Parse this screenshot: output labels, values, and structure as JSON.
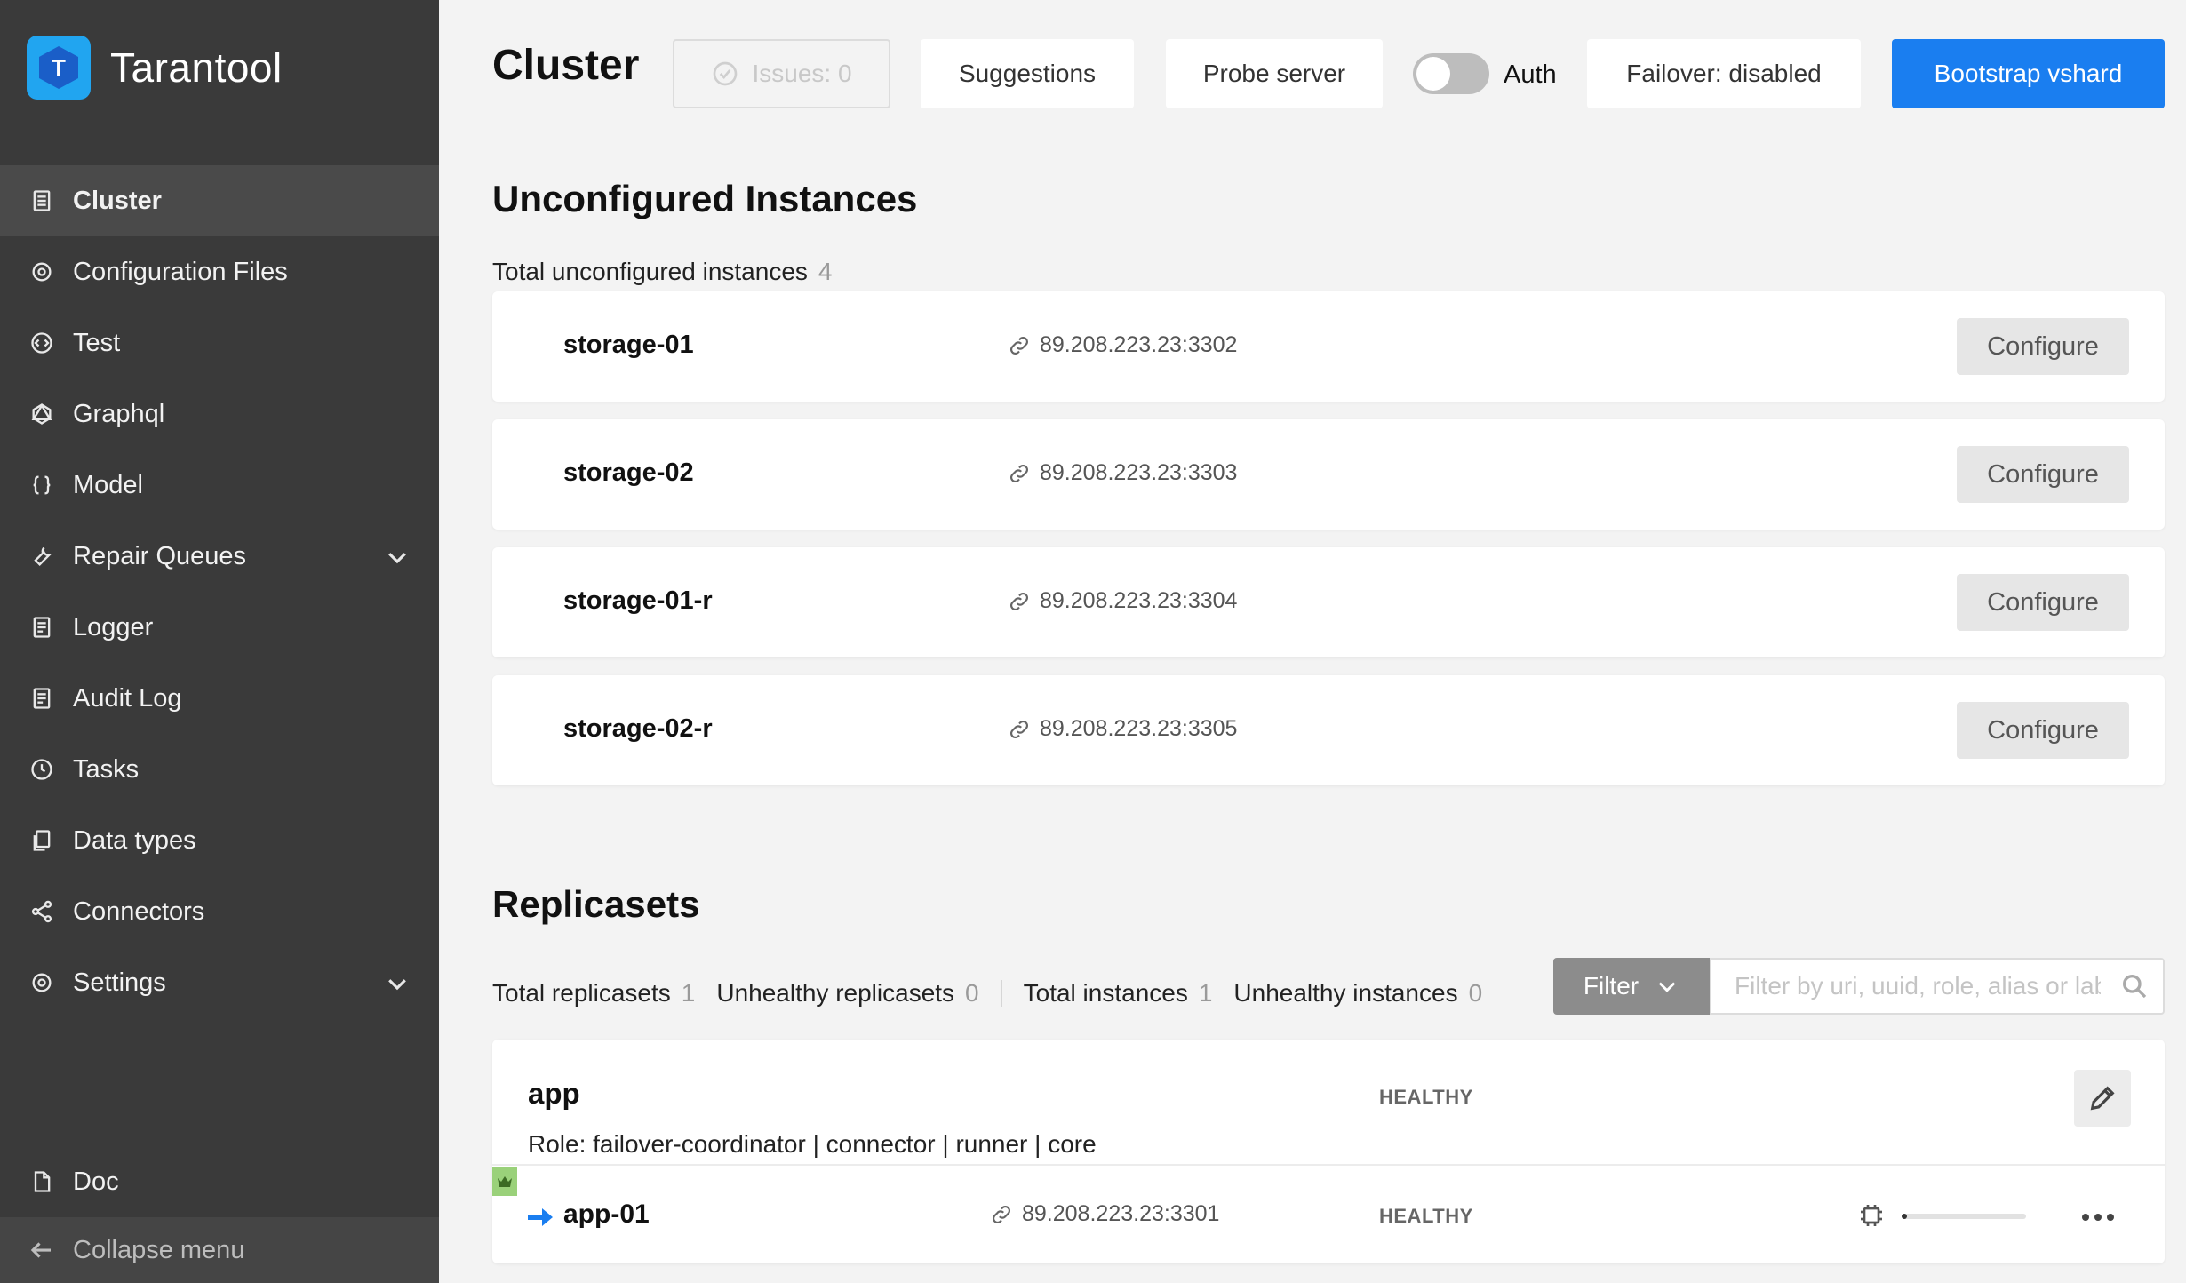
{
  "sidebar": {
    "brand": "Tarantool",
    "items": [
      {
        "label": "Cluster",
        "icon": "cluster-icon",
        "active": true
      },
      {
        "label": "Configuration Files",
        "icon": "gear-icon"
      },
      {
        "label": "Test",
        "icon": "code-icon"
      },
      {
        "label": "Graphql",
        "icon": "graphql-icon"
      },
      {
        "label": "Model",
        "icon": "braces-icon"
      },
      {
        "label": "Repair Queues",
        "icon": "wrench-icon",
        "expandable": true
      },
      {
        "label": "Logger",
        "icon": "document-icon"
      },
      {
        "label": "Audit Log",
        "icon": "document-icon"
      },
      {
        "label": "Tasks",
        "icon": "clock-icon"
      },
      {
        "label": "Data types",
        "icon": "files-icon"
      },
      {
        "label": "Connectors",
        "icon": "share-icon"
      },
      {
        "label": "Settings",
        "icon": "gear-icon",
        "expandable": true
      }
    ],
    "doc": "Doc",
    "collapse": "Collapse menu"
  },
  "header": {
    "title": "Cluster",
    "issues": "Issues: 0",
    "suggestions": "Suggestions",
    "probe": "Probe server",
    "auth_label": "Auth",
    "auth_enabled": false,
    "failover": "Failover: disabled",
    "bootstrap": "Bootstrap vshard"
  },
  "unconfigured": {
    "title": "Unconfigured Instances",
    "total_label": "Total unconfigured instances",
    "total": "4",
    "configure_label": "Configure",
    "instances": [
      {
        "name": "storage-01",
        "uri": "89.208.223.23:3302"
      },
      {
        "name": "storage-02",
        "uri": "89.208.223.23:3303"
      },
      {
        "name": "storage-01-r",
        "uri": "89.208.223.23:3304"
      },
      {
        "name": "storage-02-r",
        "uri": "89.208.223.23:3305"
      }
    ]
  },
  "replicasets": {
    "title": "Replicasets",
    "stats": [
      {
        "label": "Total replicasets",
        "value": "1"
      },
      {
        "label": "Unhealthy replicasets",
        "value": "0"
      },
      {
        "label": "Total instances",
        "value": "1"
      },
      {
        "label": "Unhealthy instances",
        "value": "0"
      }
    ],
    "filter_label": "Filter",
    "filter_placeholder": "Filter by uri, uuid, role, alias or labels",
    "items": [
      {
        "name": "app",
        "status": "HEALTHY",
        "role": "Role: failover-coordinator | connector | runner | core",
        "servers": [
          {
            "name": "app-01",
            "uri": "89.208.223.23:3301",
            "status": "HEALTHY",
            "memory_usage": 0.04,
            "leader": true
          }
        ]
      }
    ]
  },
  "colors": {
    "accent": "#1a7ef0",
    "sidebar": "#3a3a3a",
    "logo": "#21a5f0",
    "leader": "#9ad17a"
  }
}
